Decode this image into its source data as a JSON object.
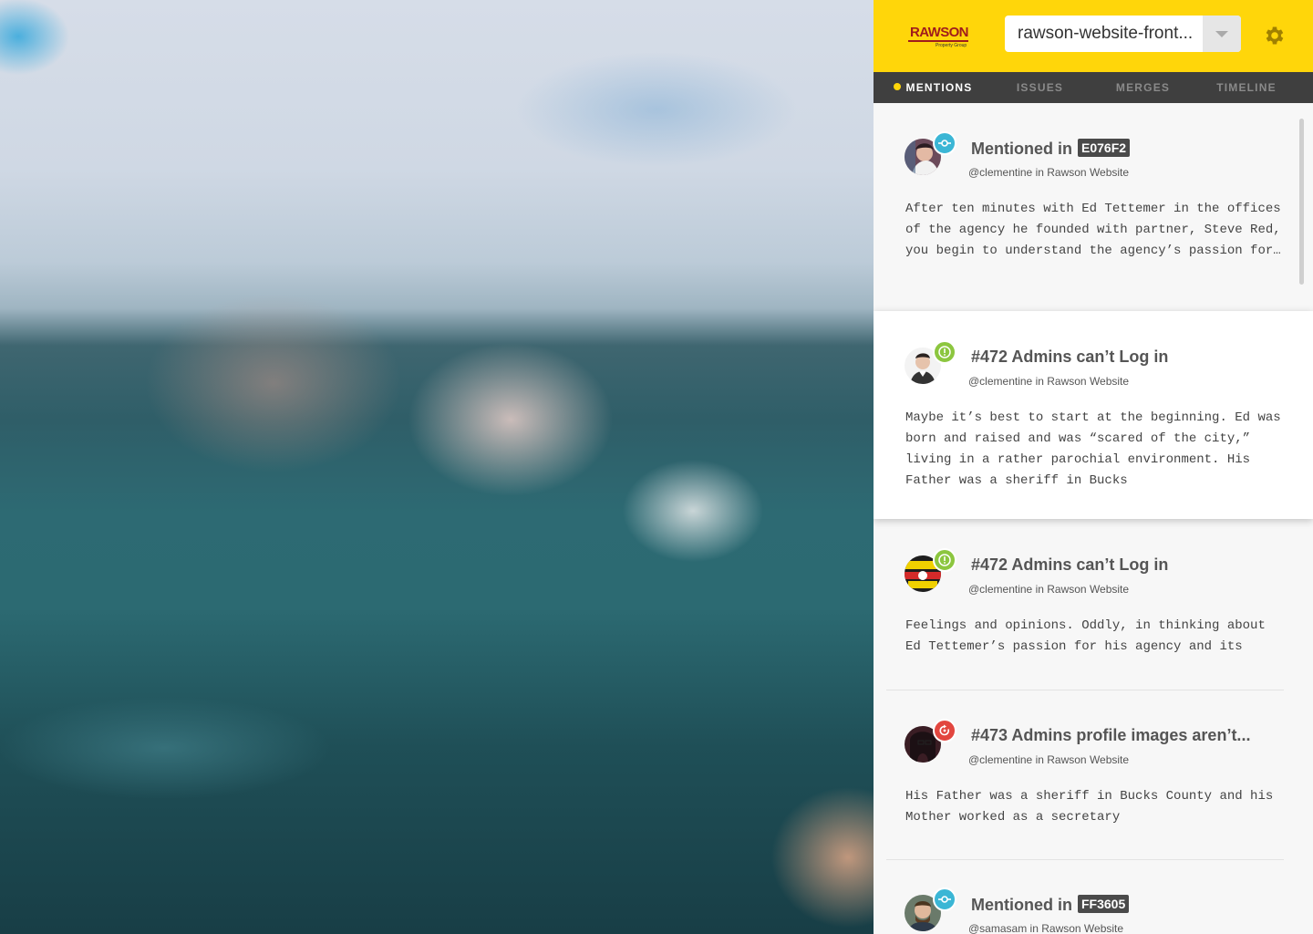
{
  "header": {
    "logo_text": "RAWSON",
    "logo_subtext": "Property Group",
    "repo_selected": "rawson-website-front...",
    "accent_color": "#ffd60a"
  },
  "tabs": [
    {
      "label": "MENTIONS",
      "active": true
    },
    {
      "label": "ISSUES",
      "active": false
    },
    {
      "label": "MERGES",
      "active": false
    },
    {
      "label": "TIMELINE",
      "active": false
    }
  ],
  "feed": [
    {
      "type": "commit",
      "icon": "commit-icon",
      "title": "Mentioned in",
      "hash": "E076F2",
      "user": "@clementine",
      "in_word": "in",
      "project": "Rawson Website",
      "body": "After ten minutes with Ed Tettemer in the offices of the agency he founded with partner, Steve Red, you begin to understand the agency’s passion for…"
    },
    {
      "type": "issue",
      "icon": "issue-icon",
      "title": "#472 Admins can’t Log in",
      "user": "@clementine",
      "in_word": "in",
      "project": "Rawson Website",
      "body": "Maybe it’s best to start at the beginning. Ed was born and raised and was “scared of the city,” living in a rather parochial environment. His Father was a sheriff in Bucks"
    },
    {
      "type": "issue",
      "icon": "issue-icon",
      "title": "#472 Admins can’t Log in",
      "user": "@clementine",
      "in_word": "in",
      "project": "Rawson Website",
      "body": "Feelings and opinions. Oddly, in thinking about Ed Tettemer’s passion for his agency and its"
    },
    {
      "type": "merge",
      "icon": "merge-icon",
      "title": "#473 Admins profile images aren’t...",
      "user": "@clementine",
      "in_word": "in",
      "project": "Rawson Website",
      "body": "His Father was a sheriff in Bucks County and his Mother worked as a secretary"
    },
    {
      "type": "commit",
      "icon": "commit-icon",
      "title": "Mentioned in",
      "hash": "FF3605",
      "user": "@samasam",
      "in_word": "in",
      "project": "Rawson Website",
      "body": ""
    }
  ]
}
